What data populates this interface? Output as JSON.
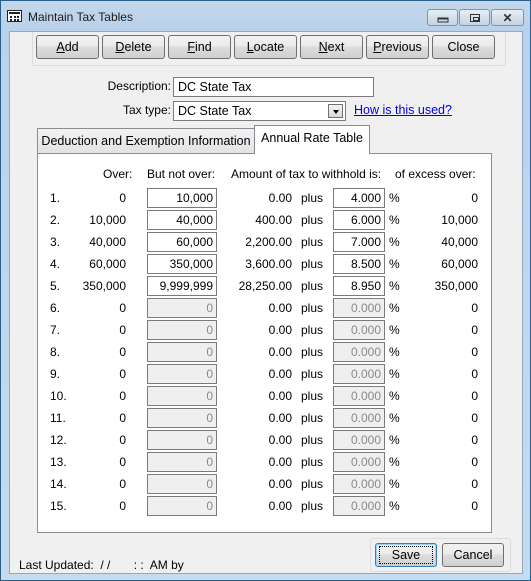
{
  "window": {
    "title": "Maintain Tax Tables",
    "icon": "table-form-icon",
    "controls": {
      "minimize": "minimize-icon",
      "maximize": "restore-icon",
      "close": "close-icon"
    }
  },
  "toolbar": {
    "buttons": [
      {
        "label": "Add",
        "accel": "A",
        "rest": "dd"
      },
      {
        "label": "Delete",
        "accel": "D",
        "rest": "elete"
      },
      {
        "label": "Find",
        "accel": "F",
        "rest": "ind"
      },
      {
        "label": "Locate",
        "accel": "L",
        "rest": "ocate"
      },
      {
        "label": "Next",
        "accel": "N",
        "rest": "ext"
      },
      {
        "label": "Previous",
        "accel": "P",
        "rest": "revious"
      },
      {
        "label": "Close",
        "accel": "",
        "rest": "Close"
      }
    ]
  },
  "form": {
    "description_label": "Description:",
    "description_value": "DC State Tax",
    "tax_type_label": "Tax type:",
    "tax_type_value": "DC State Tax",
    "help_link": "How is this used?"
  },
  "tabs": [
    {
      "label": "Deduction and Exemption Information",
      "active": false
    },
    {
      "label": "Annual Rate Table",
      "active": true
    }
  ],
  "rate_table": {
    "headers": {
      "over": "Over:",
      "but_not_over": "But not over:",
      "amount": "Amount of tax to withhold is:",
      "excess": "of excess over:"
    },
    "plus_label": "plus",
    "percent_label": "%",
    "rows": [
      {
        "num": "1.",
        "over": "0",
        "but_not_over": "10,000",
        "amount": "0.00",
        "rate": "4.000",
        "excess": "0",
        "enabled": true
      },
      {
        "num": "2.",
        "over": "10,000",
        "but_not_over": "40,000",
        "amount": "400.00",
        "rate": "6.000",
        "excess": "10,000",
        "enabled": true
      },
      {
        "num": "3.",
        "over": "40,000",
        "but_not_over": "60,000",
        "amount": "2,200.00",
        "rate": "7.000",
        "excess": "40,000",
        "enabled": true
      },
      {
        "num": "4.",
        "over": "60,000",
        "but_not_over": "350,000",
        "amount": "3,600.00",
        "rate": "8.500",
        "excess": "60,000",
        "enabled": true
      },
      {
        "num": "5.",
        "over": "350,000",
        "but_not_over": "9,999,999",
        "amount": "28,250.00",
        "rate": "8.950",
        "excess": "350,000",
        "enabled": true
      },
      {
        "num": "6.",
        "over": "0",
        "but_not_over": "0",
        "amount": "0.00",
        "rate": "0.000",
        "excess": "0",
        "enabled": false
      },
      {
        "num": "7.",
        "over": "0",
        "but_not_over": "0",
        "amount": "0.00",
        "rate": "0.000",
        "excess": "0",
        "enabled": false
      },
      {
        "num": "8.",
        "over": "0",
        "but_not_over": "0",
        "amount": "0.00",
        "rate": "0.000",
        "excess": "0",
        "enabled": false
      },
      {
        "num": "9.",
        "over": "0",
        "but_not_over": "0",
        "amount": "0.00",
        "rate": "0.000",
        "excess": "0",
        "enabled": false
      },
      {
        "num": "10.",
        "over": "0",
        "but_not_over": "0",
        "amount": "0.00",
        "rate": "0.000",
        "excess": "0",
        "enabled": false
      },
      {
        "num": "11.",
        "over": "0",
        "but_not_over": "0",
        "amount": "0.00",
        "rate": "0.000",
        "excess": "0",
        "enabled": false
      },
      {
        "num": "12.",
        "over": "0",
        "but_not_over": "0",
        "amount": "0.00",
        "rate": "0.000",
        "excess": "0",
        "enabled": false
      },
      {
        "num": "13.",
        "over": "0",
        "but_not_over": "0",
        "amount": "0.00",
        "rate": "0.000",
        "excess": "0",
        "enabled": false
      },
      {
        "num": "14.",
        "over": "0",
        "but_not_over": "0",
        "amount": "0.00",
        "rate": "0.000",
        "excess": "0",
        "enabled": false
      },
      {
        "num": "15.",
        "over": "0",
        "but_not_over": "0",
        "amount": "0.00",
        "rate": "0.000",
        "excess": "0",
        "enabled": false
      }
    ]
  },
  "footer": {
    "last_updated": "Last Updated:  / /       : :  AM by",
    "save_label": "Save",
    "cancel_label": "Cancel"
  },
  "colors": {
    "frame": "#1c6aa8",
    "client_bg": "#f0f0f0",
    "link": "#0000ee",
    "disabled_text": "#8a8a8a"
  }
}
